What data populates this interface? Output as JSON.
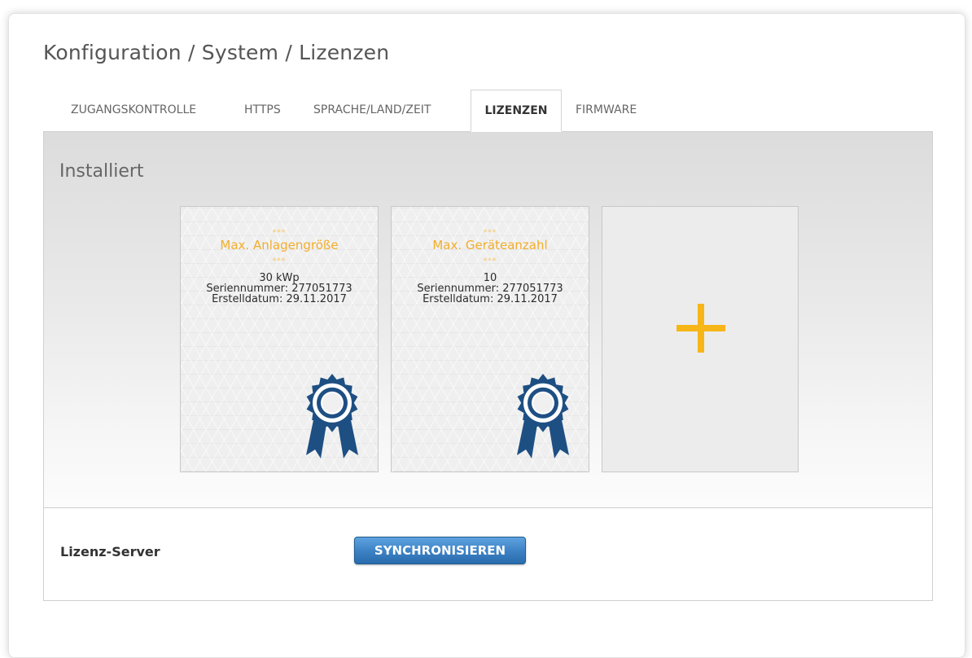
{
  "header": {
    "title": "Konfiguration / System / Lizenzen"
  },
  "tabs": [
    {
      "label": "ZUGANGSKONTROLLE",
      "active": false
    },
    {
      "label": "HTTPS",
      "active": false
    },
    {
      "label": "SPRACHE/LAND/ZEIT",
      "active": false
    },
    {
      "label": "LIZENZEN",
      "active": true
    },
    {
      "label": "FIRMWARE",
      "active": false
    }
  ],
  "installed": {
    "title": "Installiert",
    "stars": "***",
    "licenses": [
      {
        "name": "Max. Anlagengröße",
        "value": "30 kWp",
        "serial": "Seriennummer: 277051773",
        "created": "Erstelldatum: 29.11.2017",
        "icon": "award-rosette-icon"
      },
      {
        "name": "Max. Geräteanzahl",
        "value": "10",
        "serial": "Seriennummer: 277051773",
        "created": "Erstelldatum: 29.11.2017",
        "icon": "award-rosette-icon"
      }
    ],
    "add_icon": "plus-icon"
  },
  "license_server": {
    "label": "Lizenz-Server",
    "button_label": "SYNCHRONISIEREN"
  },
  "colors": {
    "accent_orange": "#f3ad2a",
    "plus_yellow": "#f7b617",
    "badge_blue": "#1e4f83",
    "button_blue": "#3e83c6"
  }
}
